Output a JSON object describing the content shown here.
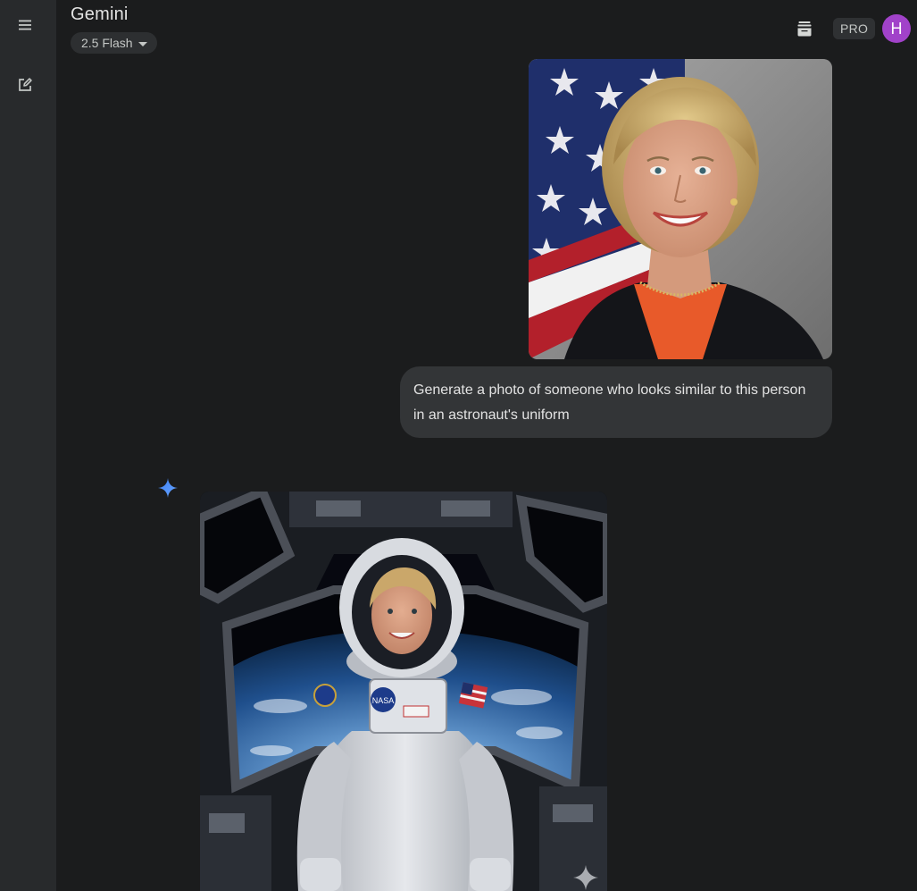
{
  "app": {
    "title": "Gemini",
    "model_label": "2.5 Flash",
    "pro_label": "PRO",
    "avatar_initial": "H"
  },
  "icons": {
    "menu": "menu-icon",
    "new_chat": "edit-icon",
    "tray": "archive-icon",
    "model_caret": "caret-down-icon",
    "gemini_spark": "gemini-spark-icon",
    "watermark": "sparkle-icon"
  },
  "colors": {
    "background": "#1b1c1d",
    "sidebar": "#282a2c",
    "bubble": "#333537",
    "avatar": "#a142c9",
    "spark": "#4b8df8"
  },
  "conversation": {
    "user_message": "Generate a photo of someone who looks similar to this person in an astronaut's uniform"
  }
}
